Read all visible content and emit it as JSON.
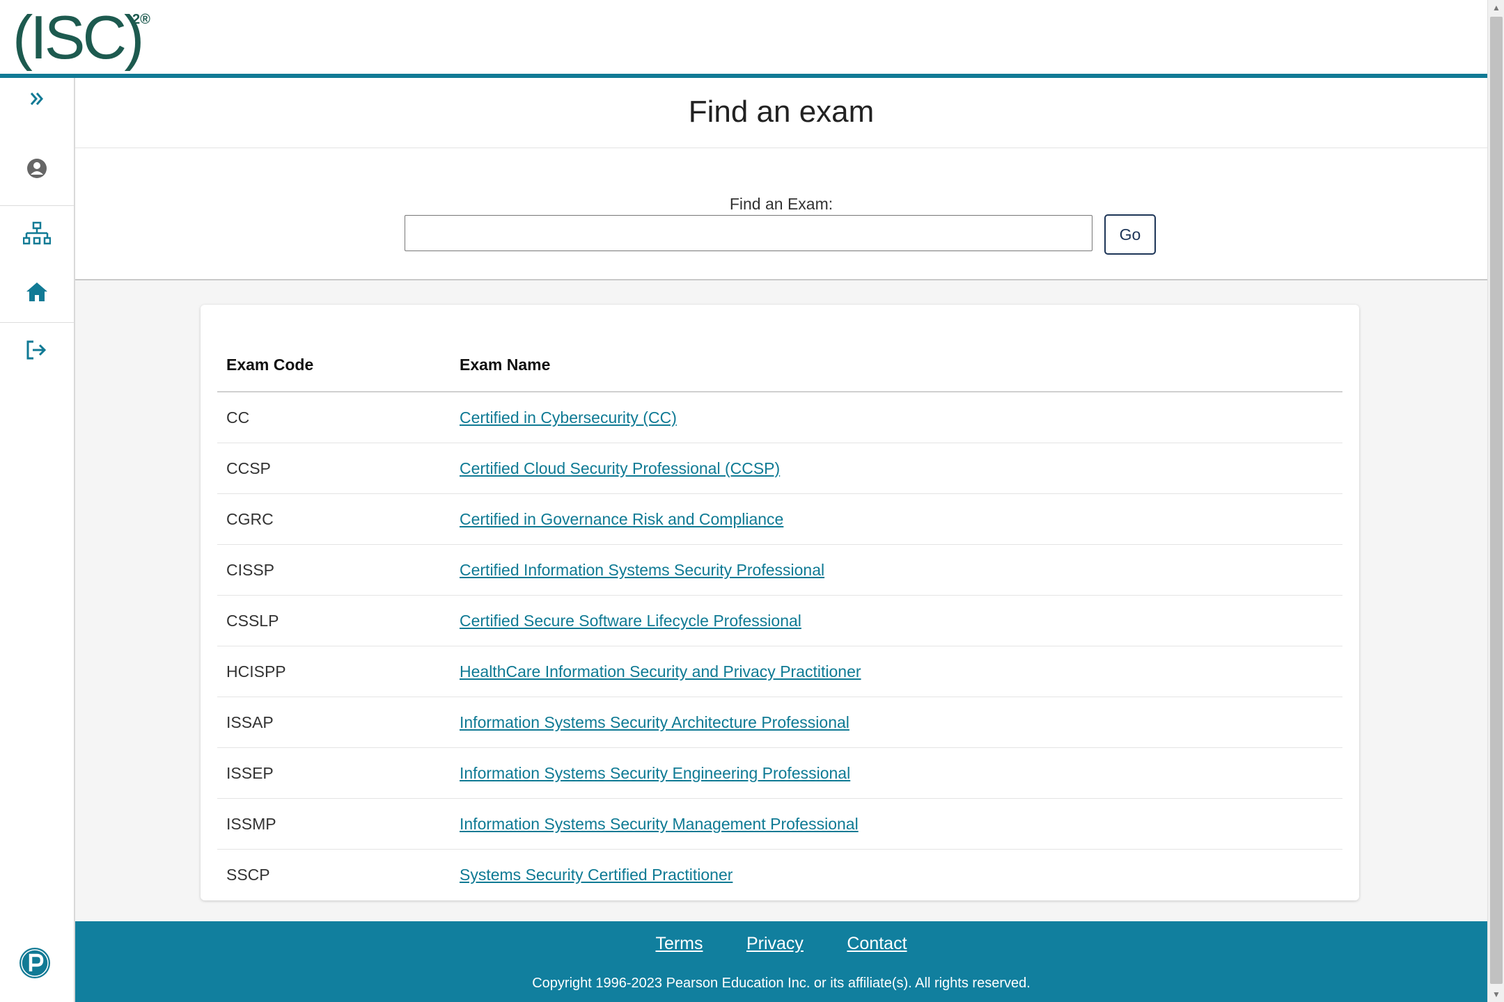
{
  "header": {
    "logo_text": "(ISC)",
    "logo_superscript": "2®",
    "accent_color": "#117a95"
  },
  "sidebar": {
    "items": [
      {
        "name": "expand",
        "icon": "double-chevron-right-icon"
      },
      {
        "name": "profile",
        "icon": "user-circle-icon"
      },
      {
        "name": "sitemap",
        "icon": "sitemap-icon"
      },
      {
        "name": "home",
        "icon": "home-icon"
      },
      {
        "name": "sign-out",
        "icon": "sign-out-icon"
      }
    ],
    "footer_icon": "pearson-logo-icon"
  },
  "main": {
    "title": "Find an exam",
    "search": {
      "label": "Find an Exam:",
      "value": "",
      "placeholder": "",
      "go_label": "Go"
    },
    "table": {
      "headers": [
        "Exam Code",
        "Exam Name"
      ],
      "rows": [
        {
          "code": "CC",
          "name": "Certified in Cybersecurity (CC)"
        },
        {
          "code": "CCSP",
          "name": "Certified Cloud Security Professional (CCSP)"
        },
        {
          "code": "CGRC",
          "name": "Certified in Governance Risk and Compliance"
        },
        {
          "code": "CISSP",
          "name": "Certified Information Systems Security Professional"
        },
        {
          "code": "CSSLP",
          "name": "Certified Secure Software Lifecycle Professional"
        },
        {
          "code": "HCISPP",
          "name": "HealthCare Information Security and Privacy Practitioner"
        },
        {
          "code": "ISSAP",
          "name": "Information Systems Security Architecture Professional"
        },
        {
          "code": "ISSEP",
          "name": "Information Systems Security Engineering Professional"
        },
        {
          "code": "ISSMP",
          "name": "Information Systems Security Management Professional"
        },
        {
          "code": "SSCP",
          "name": "Systems Security Certified Practitioner"
        }
      ]
    }
  },
  "footer": {
    "links": [
      "Terms",
      "Privacy",
      "Contact"
    ],
    "copyright": "Copyright 1996-2023 Pearson Education Inc. or its affiliate(s). All rights reserved.",
    "background_color": "#117f9e"
  }
}
